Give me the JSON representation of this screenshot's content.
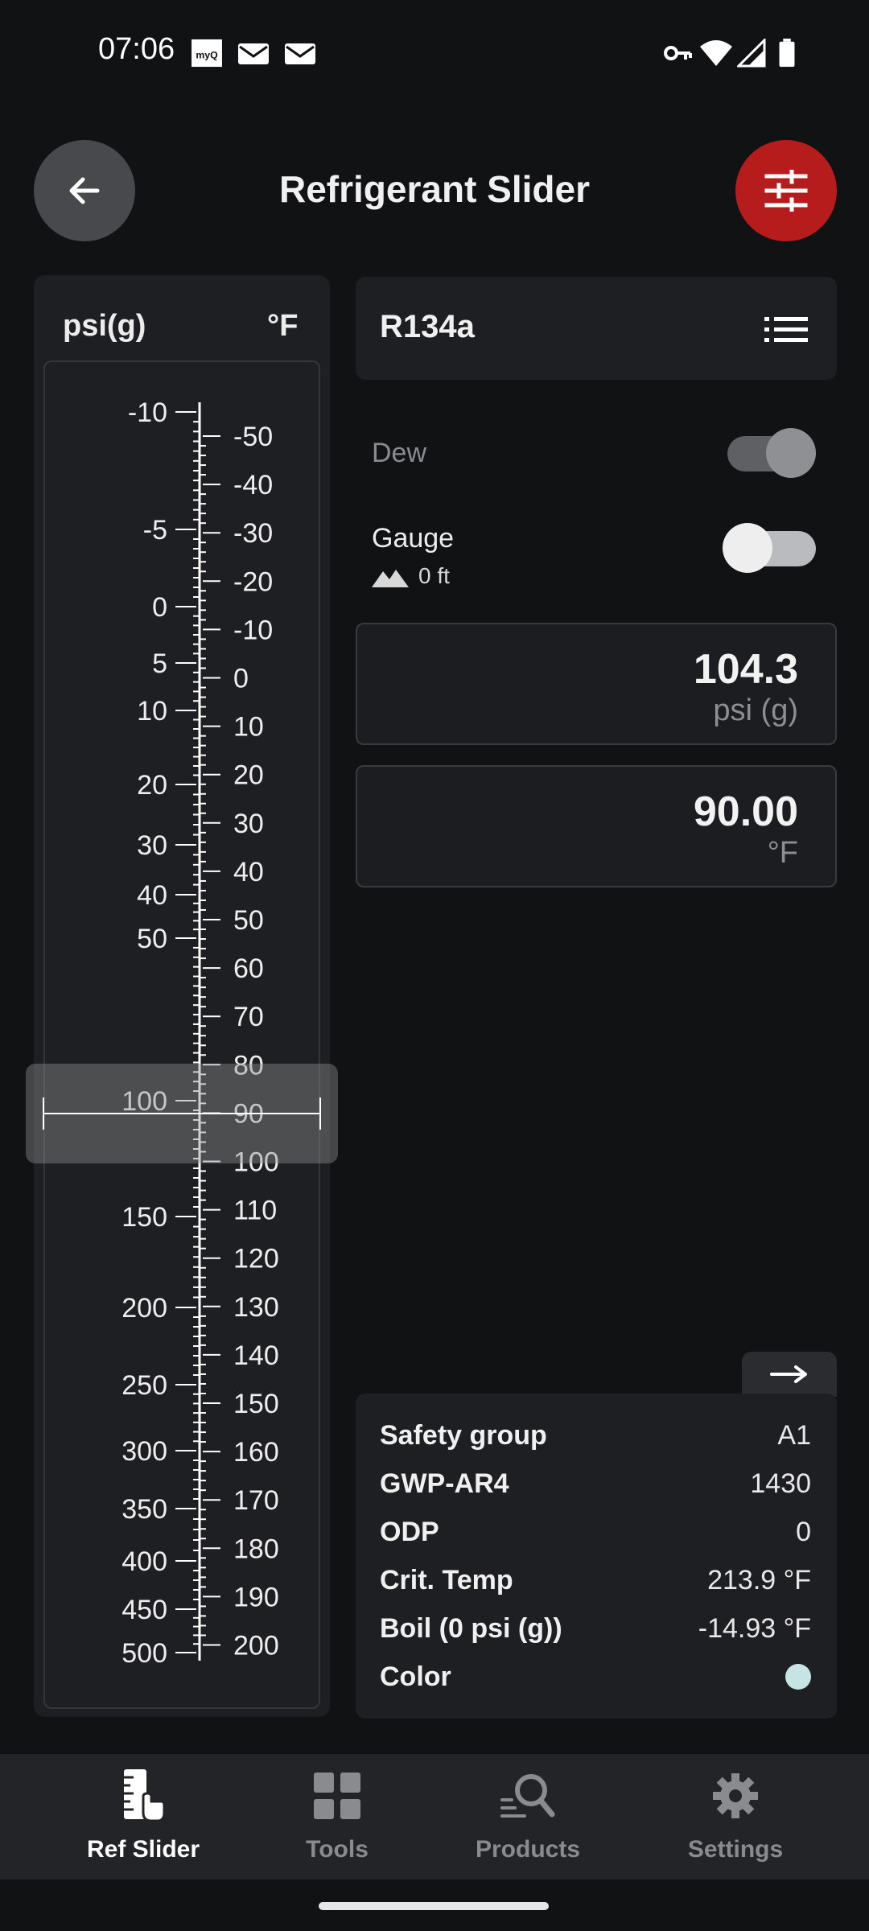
{
  "status_bar": {
    "time": "07:06",
    "notification_icons": [
      "myq-icon",
      "mail-icon",
      "mail-icon"
    ],
    "system_icons": [
      "vpn-key-icon",
      "wifi-icon",
      "signal-icon",
      "battery-icon"
    ]
  },
  "header": {
    "title": "Refrigerant Slider",
    "back_icon": "arrow-left-icon",
    "tune_icon": "sliders-icon"
  },
  "slider": {
    "pressure_unit": "psi(g)",
    "temp_unit": "°F",
    "pressure_labels": [
      "-10",
      "-5",
      "0",
      "5",
      "10",
      "20",
      "30",
      "40",
      "50",
      "100",
      "150",
      "200",
      "250",
      "300",
      "350",
      "400",
      "450",
      "500"
    ],
    "temp_labels": [
      "-50",
      "-40",
      "-30",
      "-20",
      "-10",
      "0",
      "10",
      "20",
      "30",
      "40",
      "50",
      "60",
      "70",
      "80",
      "90",
      "100",
      "110",
      "120",
      "130",
      "140",
      "150",
      "160",
      "170",
      "180",
      "190",
      "200"
    ]
  },
  "refrigerant": {
    "name": "R134a",
    "list_icon": "list-icon"
  },
  "dew": {
    "label": "Dew",
    "enabled": true
  },
  "gauge": {
    "label": "Gauge",
    "enabled": false,
    "altitude": "0 ft",
    "altitude_icon": "mountain-icon"
  },
  "pressure_field": {
    "value": "104.3",
    "unit": "psi (g)"
  },
  "temperature_field": {
    "value": "90.00",
    "unit": "°F"
  },
  "info": {
    "expand_icon": "arrow-right-icon",
    "rows": [
      {
        "key": "Safety group",
        "value": "A1"
      },
      {
        "key": "GWP-AR4",
        "value": "1430"
      },
      {
        "key": "ODP",
        "value": "0"
      },
      {
        "key": "Crit. Temp",
        "value": "213.9 °F"
      },
      {
        "key": "Boil (0 psi (g))",
        "value": "-14.93 °F"
      },
      {
        "key": "Color",
        "value": ""
      }
    ],
    "refrigerant_color": "#c6e4e4"
  },
  "nav": {
    "items": [
      {
        "label": "Ref Slider",
        "icon": "ruler-hand-icon",
        "active": true
      },
      {
        "label": "Tools",
        "icon": "grid-icon",
        "active": false
      },
      {
        "label": "Products",
        "icon": "search-icon",
        "active": false
      },
      {
        "label": "Settings",
        "icon": "gear-icon",
        "active": false
      }
    ]
  },
  "colors": {
    "accent": "#b71c1c",
    "background": "#111214",
    "card": "#1e1f22"
  }
}
